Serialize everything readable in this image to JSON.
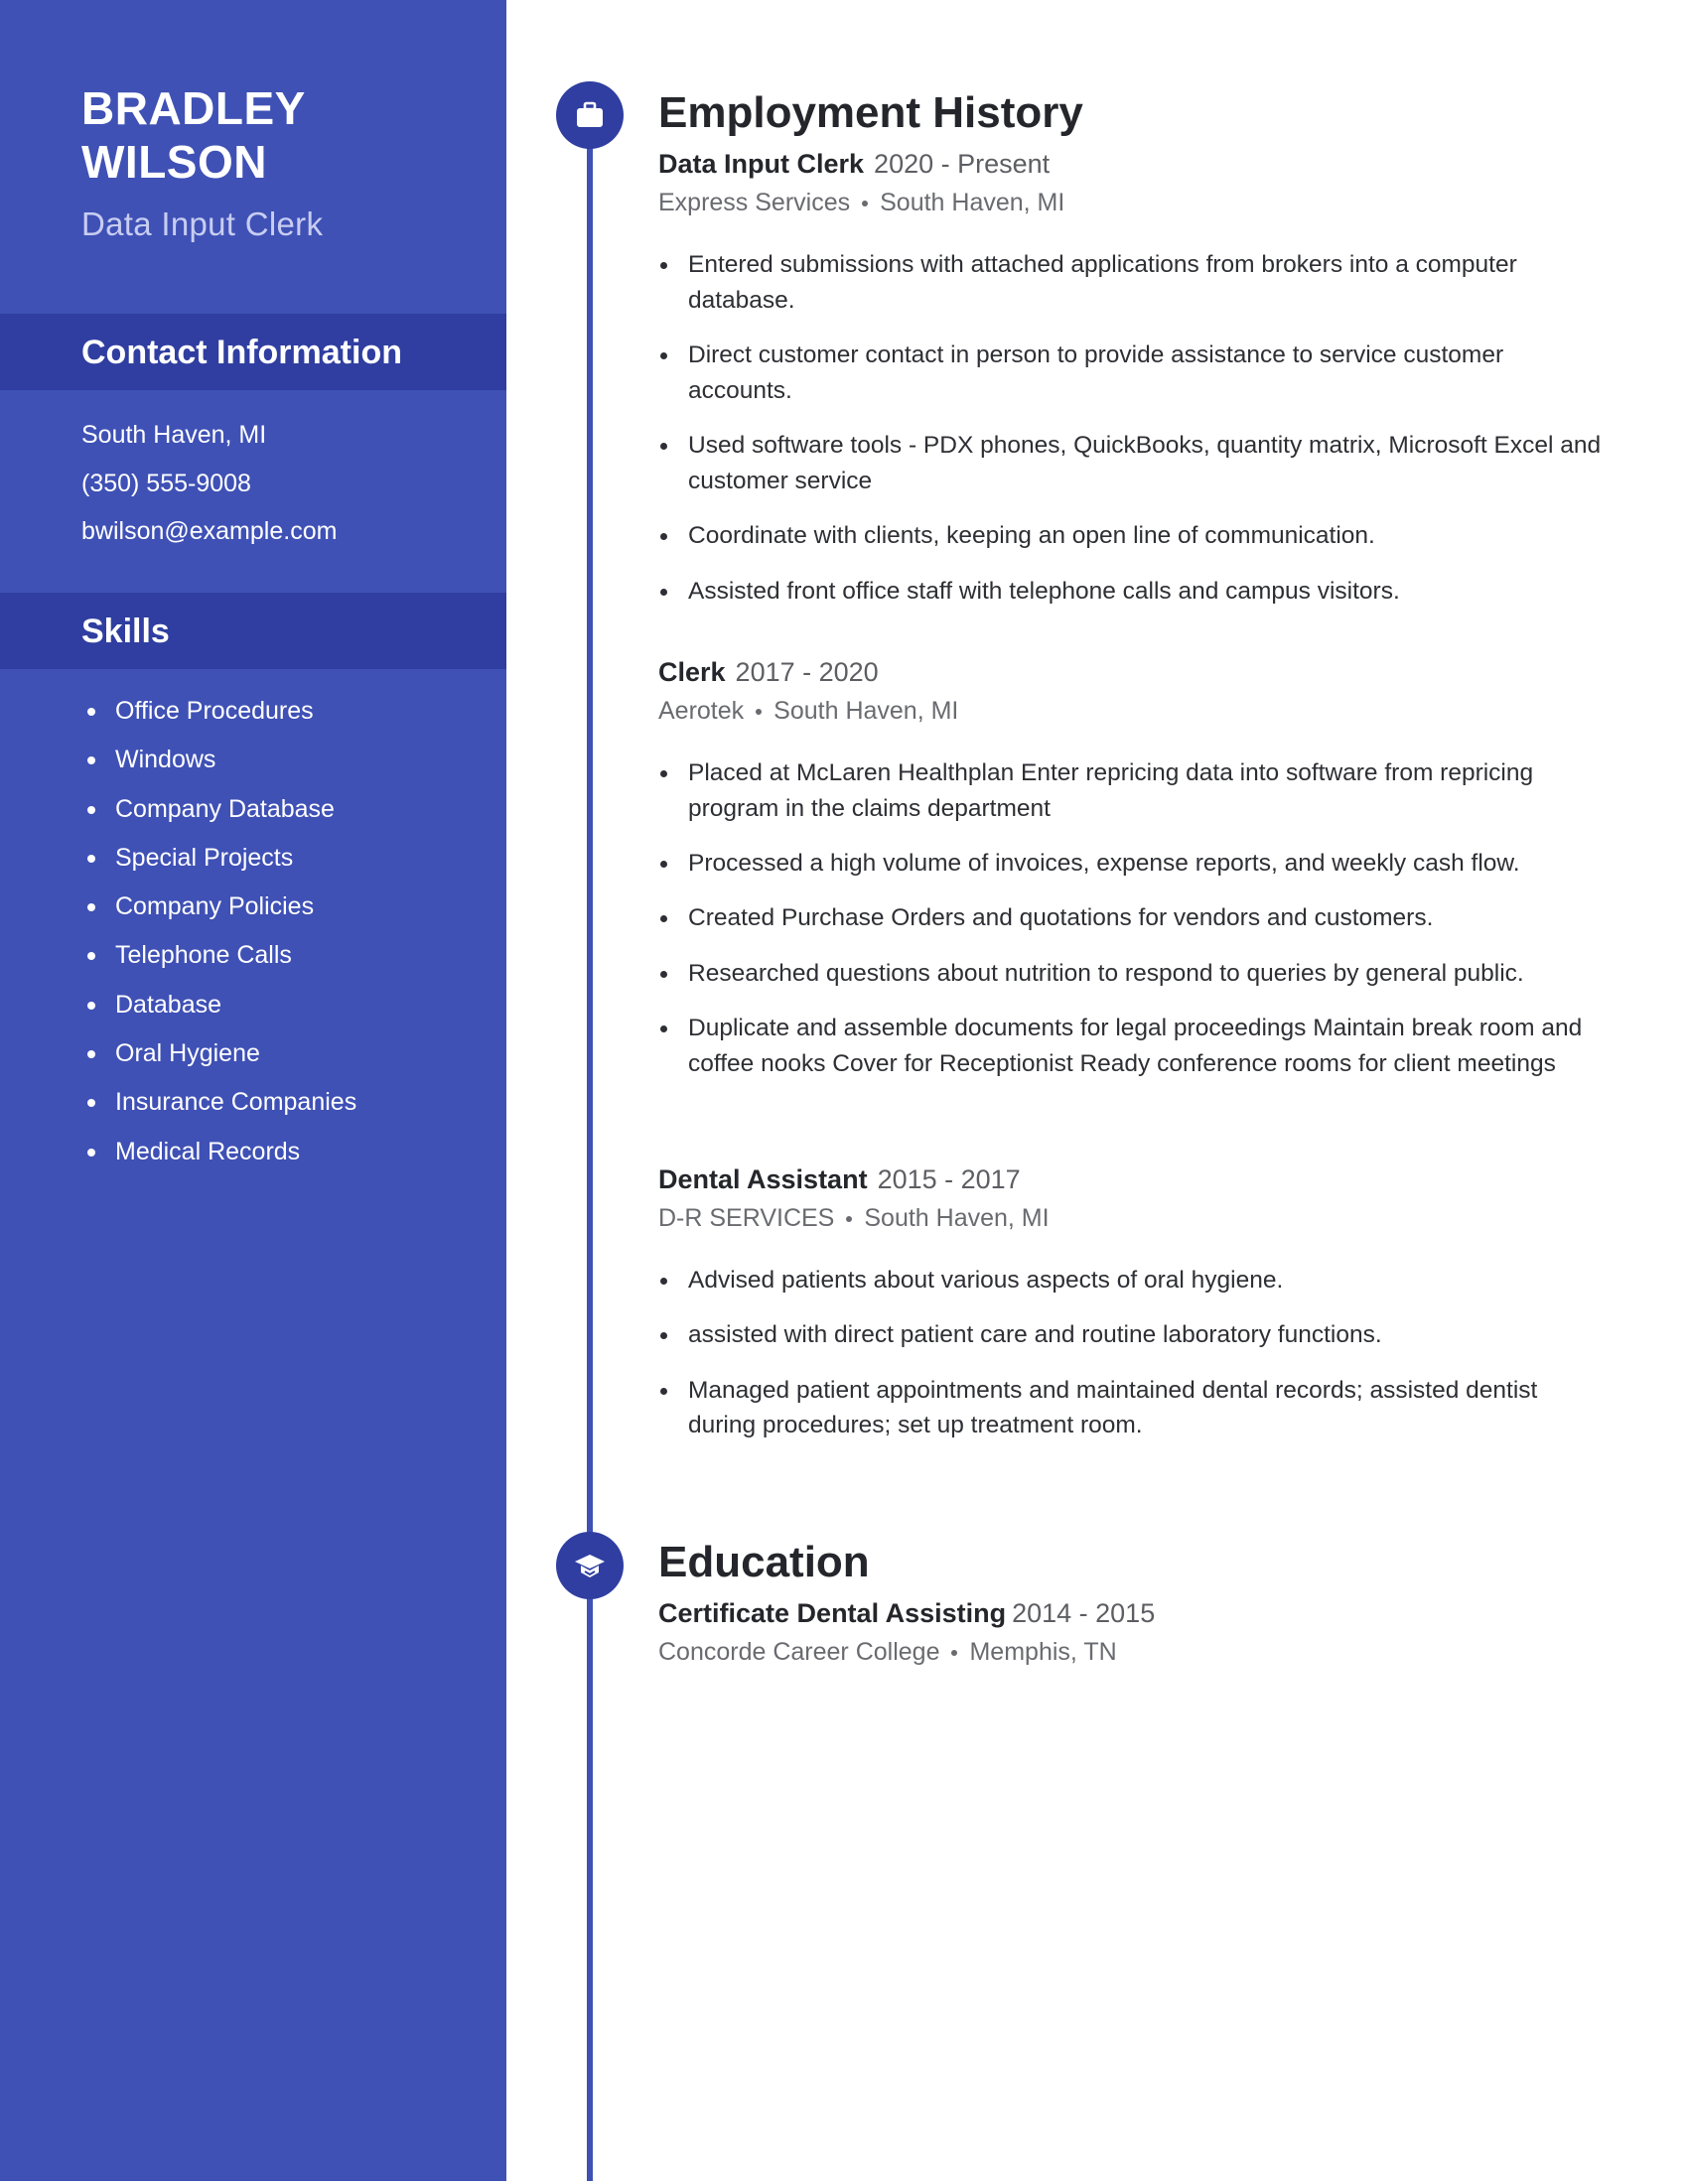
{
  "profile": {
    "first_name": "BRADLEY",
    "last_name": "WILSON",
    "headline": "Data Input Clerk"
  },
  "colors": {
    "sidebar": "#3f51b5",
    "band": "#2f3ea0",
    "headline": "#c8cdf2",
    "timeline": "#3f51b5"
  },
  "contact": {
    "title": "Contact Information",
    "items": [
      "South Haven, MI",
      "(350) 555-9008",
      "bwilson@example.com"
    ]
  },
  "skills": {
    "title": "Skills",
    "items": [
      "Office Procedures",
      "Windows",
      "Company Database",
      "Special Projects",
      "Company Policies",
      "Telephone Calls",
      "Database",
      "Oral Hygiene",
      "Insurance Companies",
      "Medical Records"
    ]
  },
  "employment": {
    "title": "Employment History",
    "icon": "briefcase-icon",
    "jobs": [
      {
        "title": "Data Input Clerk",
        "dates": "2020 - Present",
        "company": "Express Services",
        "location": "South Haven, MI",
        "bullets": [
          "Entered submissions with attached applications from brokers into a computer database.",
          "Direct customer contact in person to provide assistance to service customer accounts.",
          "Used software tools - PDX phones, QuickBooks, quantity matrix, Microsoft Excel and customer service",
          "Coordinate with clients, keeping an open line of communication.",
          "Assisted front office staff with telephone calls and campus visitors."
        ]
      },
      {
        "title": "Clerk",
        "dates": "2017 - 2020",
        "company": "Aerotek",
        "location": "South Haven, MI",
        "bullets": [
          "Placed at McLaren Healthplan Enter repricing data into software from repricing program in the claims department",
          "Processed a high volume of invoices, expense reports, and weekly cash flow.",
          "Created Purchase Orders and quotations for vendors and customers.",
          "Researched questions about nutrition to respond to queries by general public.",
          "Duplicate and assemble documents for legal proceedings Maintain break room and coffee nooks Cover for Receptionist Ready conference rooms for client meetings"
        ]
      },
      {
        "title": "Dental Assistant",
        "dates": "2015 - 2017",
        "company": "D-R SERVICES",
        "location": "South Haven, MI",
        "bullets": [
          "Advised patients about various aspects of oral hygiene.",
          "assisted with direct patient care and routine laboratory functions.",
          "Managed patient appointments and maintained dental records; assisted dentist during procedures; set up treatment room."
        ]
      }
    ]
  },
  "education": {
    "title": "Education",
    "icon": "graduation-cap-icon",
    "entries": [
      {
        "degree": "Certificate Dental Assisting",
        "dates": "2014 - 2015",
        "school": "Concorde Career College",
        "location": "Memphis, TN"
      }
    ]
  }
}
